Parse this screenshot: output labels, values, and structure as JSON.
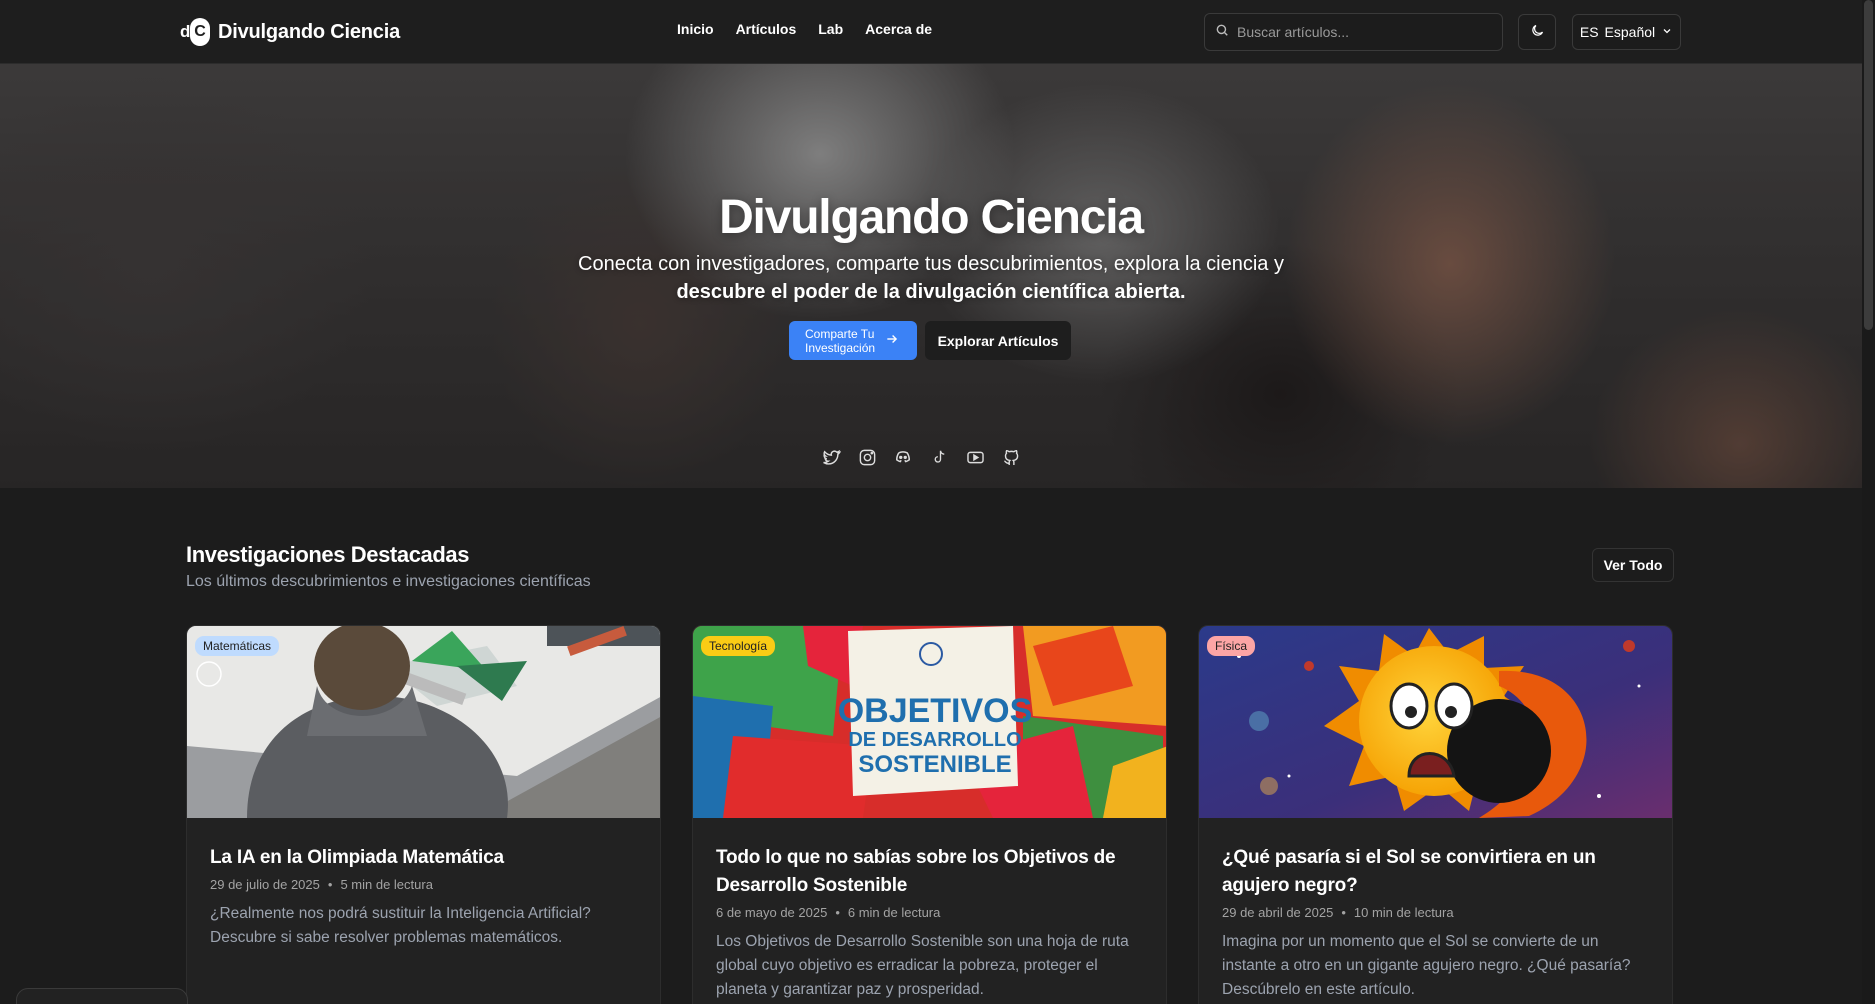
{
  "brand": {
    "name": "Divulgando Ciencia",
    "mark_d": "d",
    "mark_c": "C"
  },
  "nav": {
    "items": [
      {
        "label": "Inicio"
      },
      {
        "label": "Artículos"
      },
      {
        "label": "Lab"
      },
      {
        "label": "Acerca de"
      }
    ]
  },
  "search": {
    "placeholder": "Buscar artículos...",
    "value": ""
  },
  "language": {
    "code": "ES",
    "label": "Español"
  },
  "hero": {
    "title": "Divulgando Ciencia",
    "subtitle_line1": "Conecta con investigadores, comparte tus descubrimientos, explora la ciencia y",
    "subtitle_line2": "descubre el poder de la divulgación científica abierta.",
    "primary_button_line1": "Comparte Tu",
    "primary_button_line2": "Investigación",
    "secondary_button": "Explorar Artículos",
    "socials": [
      "twitter-icon",
      "instagram-icon",
      "discord-icon",
      "tiktok-icon",
      "youtube-icon",
      "github-icon"
    ]
  },
  "featured": {
    "title": "Investigaciones Destacadas",
    "subtitle": "Los últimos descubrimientos e investigaciones científicas",
    "see_all": "Ver Todo",
    "articles": [
      {
        "category": "Matemáticas",
        "category_color": "#bfdbfe",
        "title": "La IA en la Olimpiada Matemática",
        "date": "29 de julio de 2025",
        "read_time": "5 min de lectura",
        "excerpt": "¿Realmente nos podrá sustituir la Inteligencia Artificial? Descubre si sabe resolver problemas matemáticos."
      },
      {
        "category": "Tecnología",
        "category_color": "#facc15",
        "title": "Todo lo que no sabías sobre los Objetivos de Desarrollo Sostenible",
        "date": "6 de mayo de 2025",
        "read_time": "6 min de lectura",
        "excerpt": "Los Objetivos de Desarrollo Sostenible son una hoja de ruta global cuyo objetivo es erradicar la pobreza, proteger el planeta y garantizar paz y prosperidad.",
        "image_text_1": "OBJETIVOS",
        "image_text_2": "DE DESARROLLO",
        "image_text_3": "SOSTENIBLE"
      },
      {
        "category": "Física",
        "category_color": "#fca5a5",
        "title": "¿Qué pasaría si el Sol se convirtiera en un agujero negro?",
        "date": "29 de abril de 2025",
        "read_time": "10 min de lectura",
        "excerpt": "Imagina por un momento que el Sol se convierte de un instante a otro en un gigante agujero negro. ¿Qué pasaría? Descúbrelo en este artículo."
      }
    ]
  },
  "meta_separator": "•"
}
